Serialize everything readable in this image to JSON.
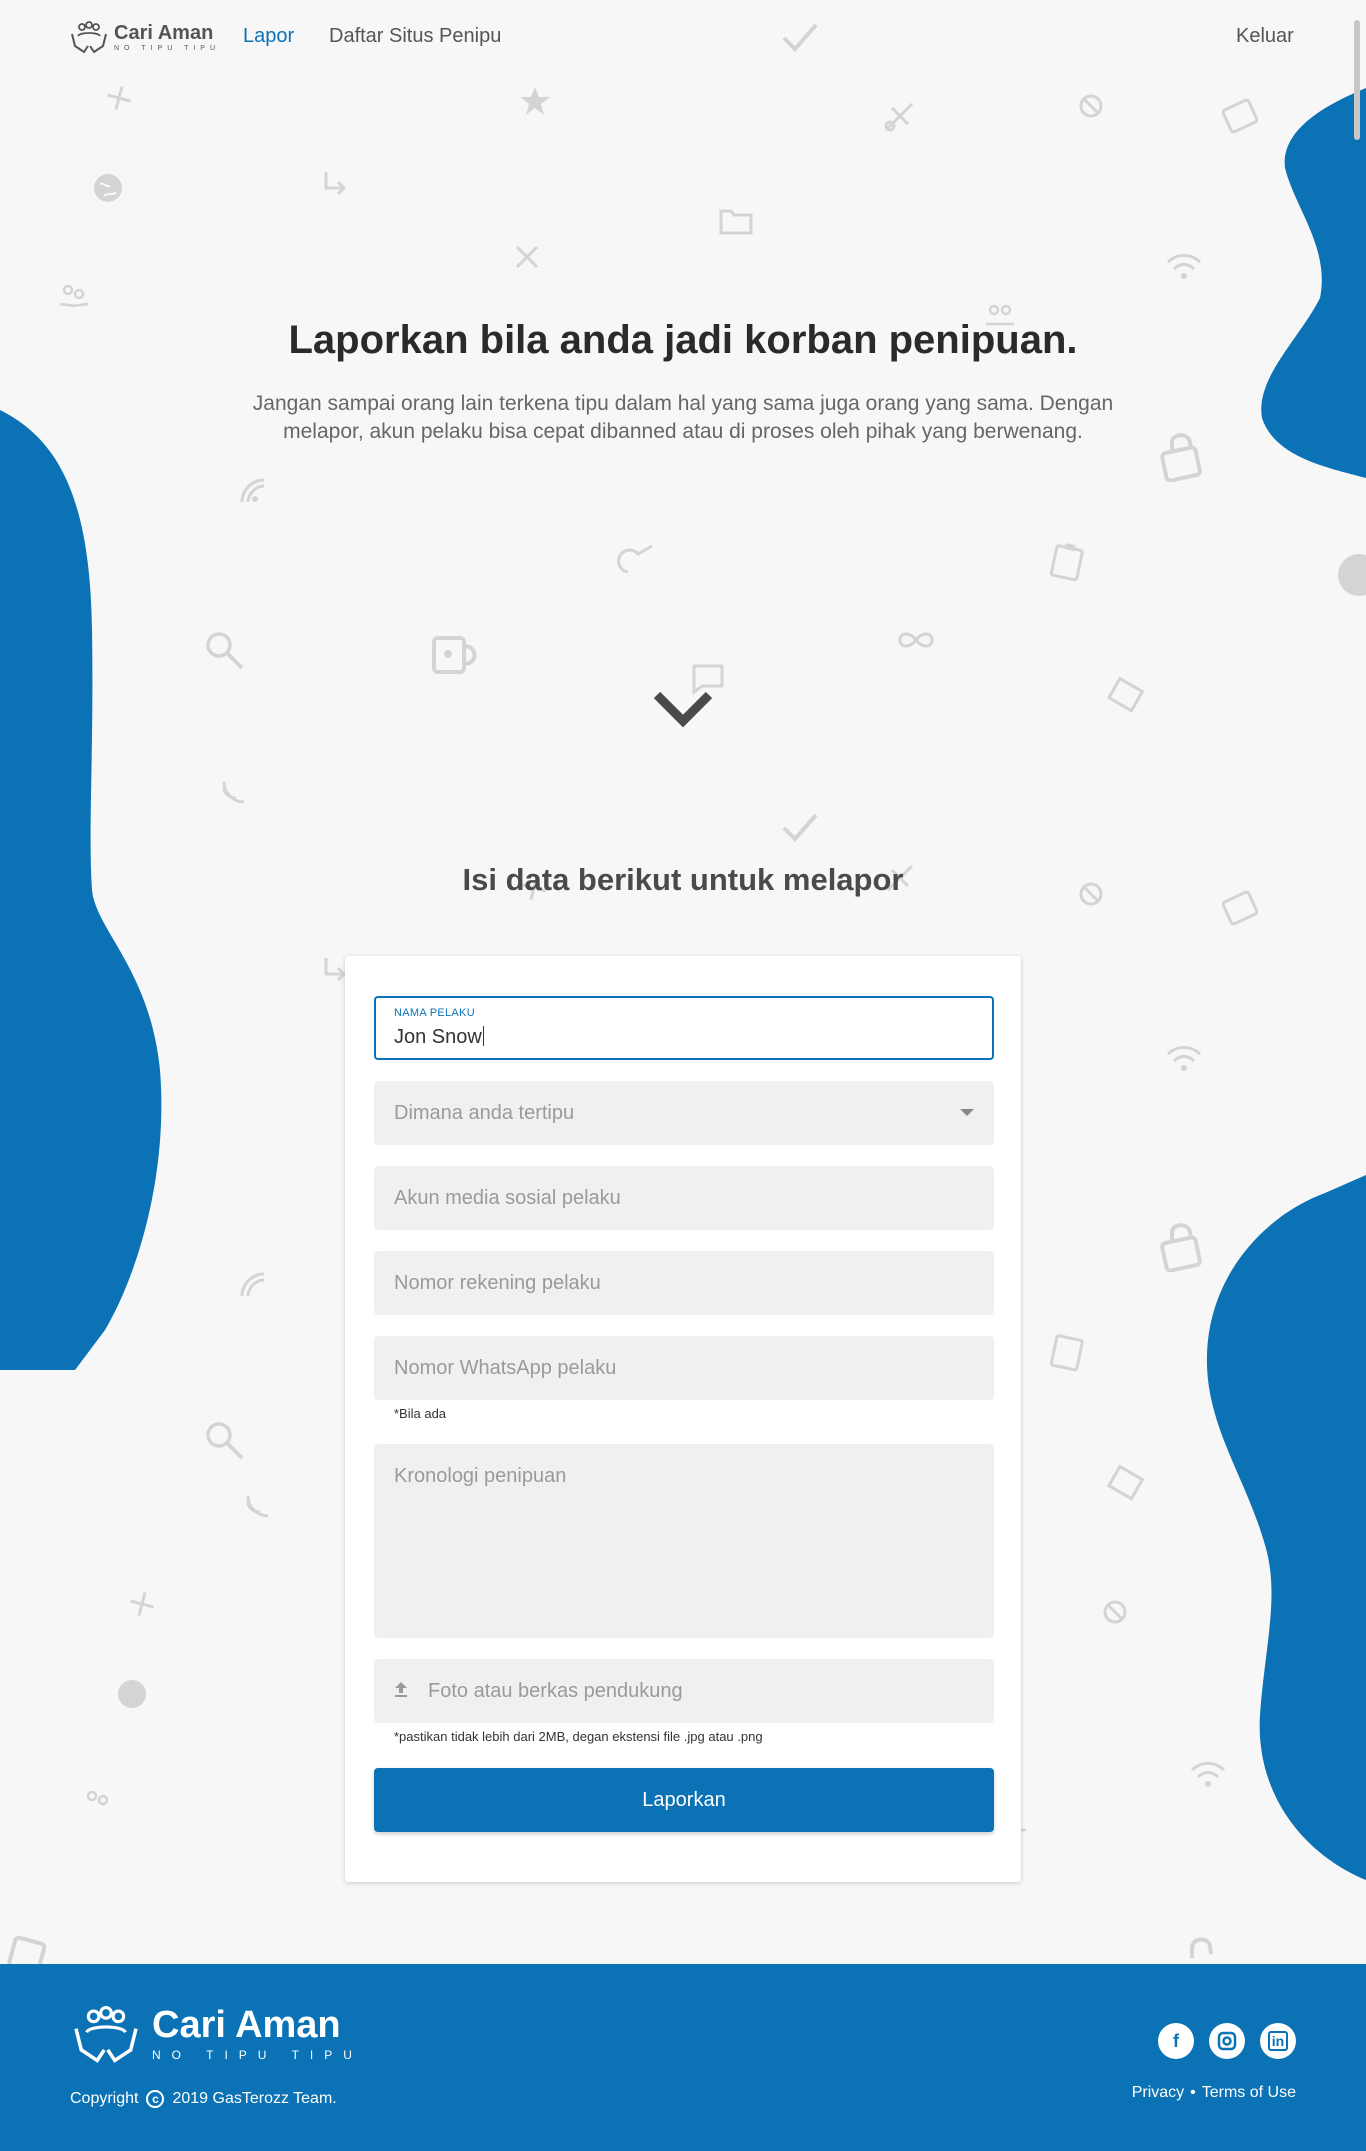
{
  "brand": {
    "name": "Cari Aman",
    "tagline": "NO TIPU TIPU"
  },
  "nav": {
    "lapor": "Lapor",
    "daftar": "Daftar Situs Penipu",
    "keluar": "Keluar"
  },
  "hero": {
    "title": "Laporkan bila anda jadi korban penipuan.",
    "description": "Jangan sampai orang lain terkena tipu dalam hal yang sama juga orang yang sama. Dengan melapor, akun pelaku bisa cepat dibanned atau di proses oleh pihak yang berwenang."
  },
  "form": {
    "heading": "Isi data berikut untuk melapor",
    "nama_label": "NAMA PELAKU",
    "nama_value": "Jon Snow",
    "platform_placeholder": "Dimana anda tertipu",
    "sosmed_placeholder": "Akun media sosial pelaku",
    "rekening_placeholder": "Nomor rekening pelaku",
    "whatsapp_placeholder": "Nomor WhatsApp pelaku",
    "whatsapp_hint": "*Bila ada",
    "kronologi_placeholder": "Kronologi penipuan",
    "upload_placeholder": "Foto atau berkas pendukung",
    "upload_hint": "*pastikan tidak lebih dari 2MB, degan ekstensi file .jpg atau .png",
    "submit_label": "Laporkan"
  },
  "footer": {
    "copyright_prefix": "Copyright",
    "copyright_text": "2019 GasTerozz Team.",
    "copyright_symbol": "c",
    "privacy": "Privacy",
    "separator": "•",
    "terms": "Terms of Use",
    "social": [
      "f",
      "ig",
      "in"
    ]
  },
  "colors": {
    "primary": "#0b72b5",
    "background": "#f7f7f7",
    "icon_gray": "#d4d4d4"
  }
}
